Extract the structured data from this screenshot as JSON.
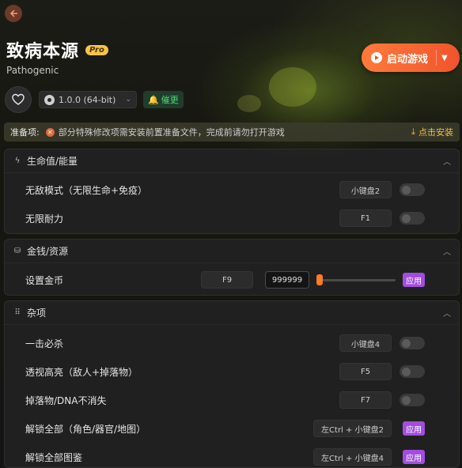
{
  "header": {
    "back_icon": "arrow-left-icon",
    "title": "致病本源",
    "pro_badge": "Pro",
    "subtitle": "Pathogenic",
    "launch_label": "启动游戏",
    "launch_icon": "play-icon",
    "favorite_icon": "heart-icon",
    "version": "1.0.0 (64-bit)",
    "version_icon": "steam-icon",
    "update_label": "催更",
    "update_icon": "bell-icon"
  },
  "prep": {
    "label": "准备项:",
    "text": "部分特殊修改项需安装前置准备文件，完成前请勿打开游戏",
    "action": "点击安装",
    "action_icon": "download-icon"
  },
  "sections": {
    "health": {
      "title": "生命值/能量",
      "icon": "lightning-icon",
      "rows": [
        {
          "label": "无敌模式（无限生命+免疫）",
          "key": "小键盘2"
        },
        {
          "label": "无限耐力",
          "key": "F1"
        }
      ]
    },
    "money": {
      "title": "金钱/资源",
      "icon": "money-bag-icon",
      "rows": [
        {
          "label": "设置金币",
          "key": "F9",
          "value": "999999",
          "apply": "应用",
          "slider_fraction": 0.05
        }
      ]
    },
    "misc": {
      "title": "杂项",
      "icon": "grid-icon",
      "rows": [
        {
          "label": "一击必杀",
          "key": "小键盘4"
        },
        {
          "label": "透视高亮（敌人+掉落物）",
          "key": "F5"
        },
        {
          "label": "掉落物/DNA不消失",
          "key": "F7"
        },
        {
          "label": "解锁全部（角色/器官/地图）",
          "key": "左Ctrl + 小键盘2",
          "apply": "应用"
        },
        {
          "label": "解锁全部图鉴",
          "key": "左Ctrl + 小键盘4",
          "apply": "应用"
        }
      ]
    }
  },
  "colors": {
    "accent": "#f0542c",
    "apply": "#a24de0",
    "update": "#4bd97a",
    "install": "#f0c040"
  }
}
